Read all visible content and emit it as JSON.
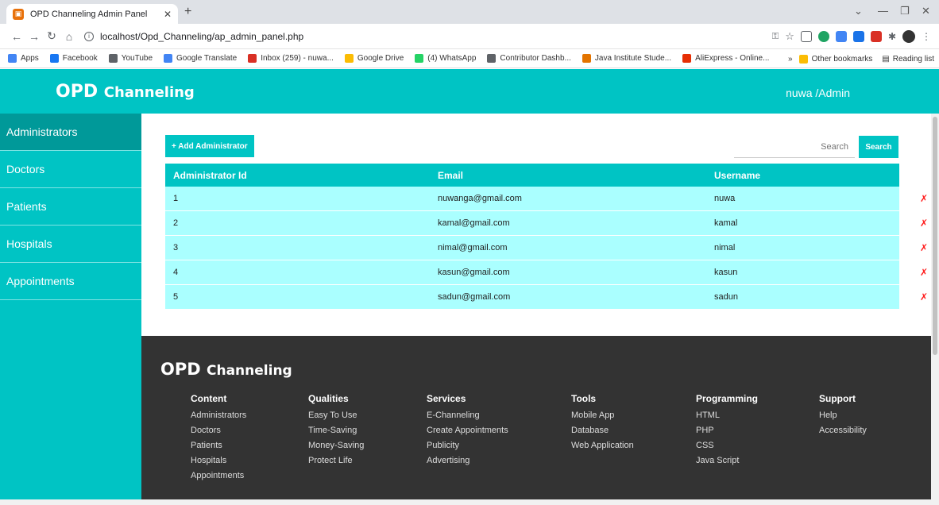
{
  "browser": {
    "tab_title": "OPD Channeling Admin Panel",
    "url": "localhost/Opd_Channeling/ap_admin_panel.php",
    "bookmarks": [
      {
        "label": "Apps",
        "color": "#4285f4"
      },
      {
        "label": "Facebook",
        "color": "#1877f2"
      },
      {
        "label": "YouTube",
        "color": "#5f6368"
      },
      {
        "label": "Google Translate",
        "color": "#4285f4"
      },
      {
        "label": "Inbox (259) - nuwa...",
        "color": "#d93025"
      },
      {
        "label": "Google Drive",
        "color": "#fbbc04"
      },
      {
        "label": "(4) WhatsApp",
        "color": "#25d366"
      },
      {
        "label": "Contributor Dashb...",
        "color": "#5f6368"
      },
      {
        "label": "Java Institute Stude...",
        "color": "#e37400"
      },
      {
        "label": "AliExpress - Online...",
        "color": "#e62e04"
      }
    ],
    "other_bookmarks": "Other bookmarks",
    "reading_list": "Reading list"
  },
  "header": {
    "brand_main": "OPD",
    "brand_sub": "Channeling",
    "user": "nuwa /Admin"
  },
  "sidebar": {
    "items": [
      {
        "label": "Administrators",
        "active": true
      },
      {
        "label": "Doctors",
        "active": false
      },
      {
        "label": "Patients",
        "active": false
      },
      {
        "label": "Hospitals",
        "active": false
      },
      {
        "label": "Appointments",
        "active": false
      }
    ]
  },
  "toolbar": {
    "add_label": "+ Add Administrator",
    "search_placeholder": "Search",
    "search_label": "Search"
  },
  "table": {
    "headers": [
      "Administrator Id",
      "Email",
      "Username"
    ],
    "rows": [
      [
        "1",
        "nuwanga@gmail.com",
        "nuwa"
      ],
      [
        "2",
        "kamal@gmail.com",
        "kamal"
      ],
      [
        "3",
        "nimal@gmail.com",
        "nimal"
      ],
      [
        "4",
        "kasun@gmail.com",
        "kasun"
      ],
      [
        "5",
        "sadun@gmail.com",
        "sadun"
      ]
    ],
    "delete_symbol": "✗"
  },
  "footer": {
    "brand_main": "OPD",
    "brand_sub": "Channeling",
    "columns": [
      {
        "title": "Content",
        "items": [
          "Administrators",
          "Doctors",
          "Patients",
          "Hospitals",
          "Appointments"
        ]
      },
      {
        "title": "Qualities",
        "items": [
          "Easy To Use",
          "Time-Saving",
          "Money-Saving",
          "Protect Life"
        ]
      },
      {
        "title": "Services",
        "items": [
          "E-Channeling",
          "Create Appointments",
          "Publicity",
          "Advertising"
        ]
      },
      {
        "title": "Tools",
        "items": [
          "Mobile App",
          "Database",
          "Web Application"
        ]
      },
      {
        "title": "Programming",
        "items": [
          "HTML",
          "PHP",
          "CSS",
          "Java Script"
        ]
      },
      {
        "title": "Support",
        "items": [
          "Help",
          "Accessibility"
        ]
      }
    ]
  },
  "colors": {
    "accent": "#00c4c4",
    "row": "#aaffff",
    "footer": "#333333",
    "delete": "#ff1a1a"
  }
}
